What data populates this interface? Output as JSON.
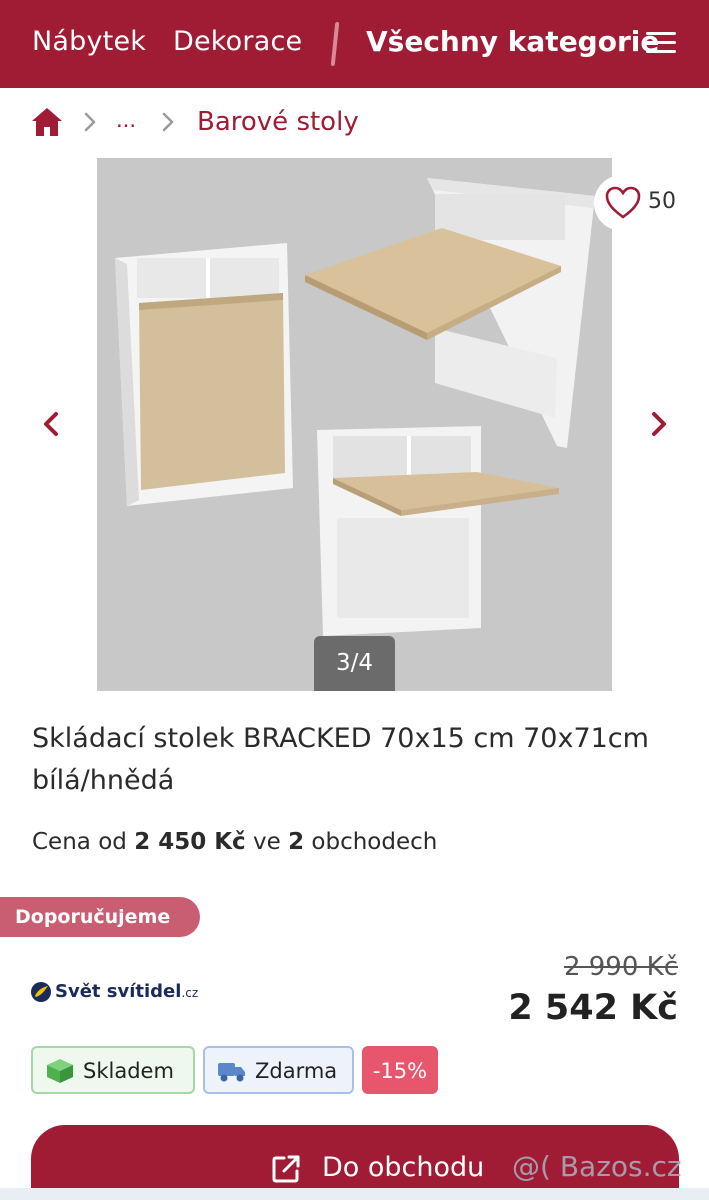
{
  "nav": {
    "links": [
      "Nábytek",
      "Dekorace"
    ],
    "all_categories": "Všechny kategorie",
    "menu_icon": "hamburger-icon"
  },
  "breadcrumb": {
    "home_icon": "home-icon",
    "ellipsis": "...",
    "current": "Barové stoly"
  },
  "gallery": {
    "counter": "3/4",
    "favorite_count": "50",
    "prev_icon": "chevron-left-icon",
    "next_icon": "chevron-right-icon"
  },
  "product": {
    "title": "Skládací stolek BRACKED 70x15 cm 70x71cm bílá/hnědá",
    "price_from_prefix": "Cena od",
    "price_from_value": "2 450 Kč",
    "price_from_mid": "ve",
    "shop_count": "2",
    "price_from_suffix": "obchodech"
  },
  "offer": {
    "badge": "Doporučujeme",
    "shop_name": "Svět svítidel",
    "shop_tld": ".cz",
    "old_price": "2 990 Kč",
    "new_price": "2 542 Kč",
    "tags": {
      "stock": "Skladem",
      "shipping": "Zdarma",
      "discount": "-15%"
    },
    "cta": "Do obchodu"
  },
  "watermark": "@( Bazos.cz",
  "colors": {
    "brand": "#a01c35",
    "badge": "#c95e73",
    "discount": "#e7566c"
  }
}
